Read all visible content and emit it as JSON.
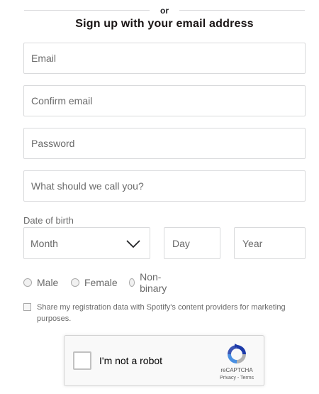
{
  "divider": {
    "text": "or"
  },
  "heading": "Sign up with your email address",
  "fields": {
    "email": "Email",
    "confirm_email": "Confirm email",
    "password": "Password",
    "display_name": "What should we call you?"
  },
  "dob": {
    "label": "Date of birth",
    "month": "Month",
    "day": "Day",
    "year": "Year"
  },
  "gender": [
    "Male",
    "Female",
    "Non-binary"
  ],
  "share": {
    "text": "Share my registration data with Spotify's content providers for marketing purposes."
  },
  "captcha": {
    "label": "I'm not a robot",
    "brand": "reCAPTCHA",
    "privacy": "Privacy",
    "separator": " - ",
    "terms": "Terms"
  },
  "colors": {
    "border": "#d9dadc",
    "text": "#222326",
    "placeholder": "#6a6a6a",
    "captcha_blue": "#1c3aa9",
    "captcha_light_blue": "#4a90e2",
    "captcha_gray": "#b1b1b1"
  }
}
